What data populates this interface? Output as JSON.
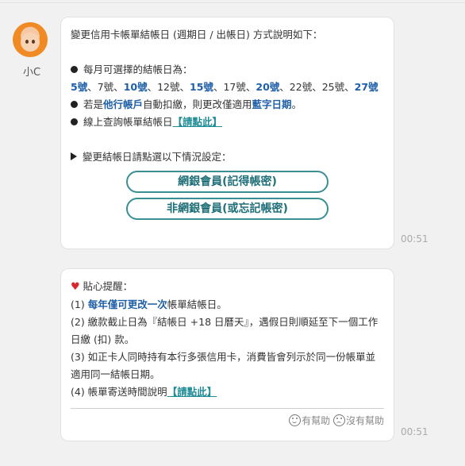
{
  "bot": {
    "name": "小C",
    "avatar_icon": "girl-avatar-icon"
  },
  "message1": {
    "intro": "變更信用卡帳單結帳日 (週期日 / 出帳日) 方式說明如下：",
    "days_label": "每月可選擇的結帳日為：",
    "days": [
      {
        "text": "5號",
        "highlight": true
      },
      {
        "text": "7號",
        "highlight": false
      },
      {
        "text": "10號",
        "highlight": true
      },
      {
        "text": "12號",
        "highlight": false
      },
      {
        "text": "15號",
        "highlight": true
      },
      {
        "text": "17號",
        "highlight": false
      },
      {
        "text": "20號",
        "highlight": true
      },
      {
        "text": "22號",
        "highlight": false
      },
      {
        "text": "25號",
        "highlight": false
      },
      {
        "text": "27號",
        "highlight": true
      }
    ],
    "bullet2_pre": "若是",
    "bullet2_hl1": "他行帳戶",
    "bullet2_mid": "自動扣繳，則更改僅適用",
    "bullet2_hl2": "藍字日期",
    "bullet2_post": "。",
    "bullet3_text": "線上查詢帳單結帳日",
    "bullet3_link": "【請點此】",
    "choose_text": "變更結帳日請點選以下情況設定：",
    "button1": "網銀會員(記得帳密)",
    "button2": "非網銀會員(或忘記帳密)",
    "time": "00:51"
  },
  "message2": {
    "title": "貼心提醒：",
    "tip1_pre": "(1) ",
    "tip1_hl": "每年僅可更改一次",
    "tip1_post": "帳單結帳日。",
    "tip2": "(2) 繳款截止日為『結帳日 +18 日曆天』，遇假日則順延至下一個工作日繳 (扣) 款。",
    "tip3": "(3) 如正卡人同時持有本行多張信用卡，消費皆會列示於同一份帳單並適用同一結帳日期。",
    "tip4_text": "(4) 帳單寄送時間說明",
    "tip4_link": "【請點此】",
    "helpful": "有幫助",
    "not_helpful": "沒有幫助",
    "time": "00:51"
  },
  "colors": {
    "highlight_blue": "#1f5fa8",
    "link_teal": "#1f8c96",
    "button_border": "#3a8f94",
    "heart_red": "#d8282d"
  }
}
